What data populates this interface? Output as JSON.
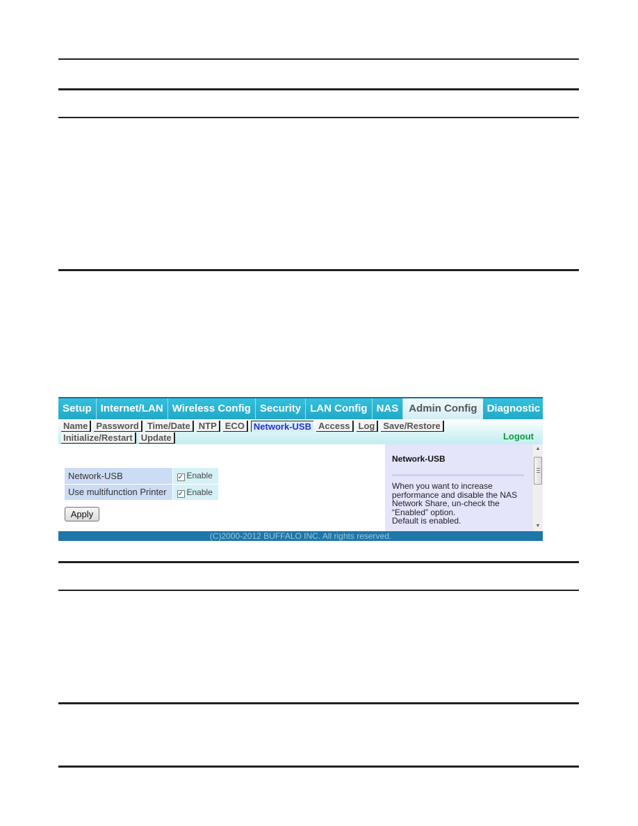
{
  "top_nav": {
    "tabs": [
      {
        "label": "Setup",
        "active": false
      },
      {
        "label": "Internet/LAN",
        "active": false
      },
      {
        "label": "Wireless Config",
        "active": false
      },
      {
        "label": "Security",
        "active": false
      },
      {
        "label": "LAN Config",
        "active": false
      },
      {
        "label": "NAS",
        "active": false
      },
      {
        "label": "Admin Config",
        "active": true
      },
      {
        "label": "Diagnostic",
        "active": false
      }
    ]
  },
  "sub_nav": {
    "row1": [
      {
        "label": "Name",
        "active": false
      },
      {
        "label": "Password",
        "active": false
      },
      {
        "label": "Time/Date",
        "active": false
      },
      {
        "label": "NTP",
        "active": false
      },
      {
        "label": "ECO",
        "active": false
      },
      {
        "label": "Network-USB",
        "active": true
      },
      {
        "label": "Access",
        "active": false
      },
      {
        "label": "Log",
        "active": false
      },
      {
        "label": "Save/Restore",
        "active": false
      }
    ],
    "row2": [
      {
        "label": "Initialize/Restart",
        "active": false
      },
      {
        "label": "Update",
        "active": false
      }
    ],
    "logout_label": "Logout"
  },
  "settings": {
    "rows": [
      {
        "label": "Network-USB",
        "checked": true,
        "option_label": "Enable"
      },
      {
        "label": "Use multifunction Printer",
        "checked": true,
        "option_label": "Enable"
      }
    ],
    "apply_label": "Apply"
  },
  "help": {
    "title": "Network-USB",
    "text_lines": [
      "When you want to increase",
      "performance and disable the NAS",
      "Network Share, un-check the",
      "“Enabled” option.",
      "Default is enabled."
    ]
  },
  "footer": {
    "copyright": "(C)2000-2012 BUFFALO INC. All rights reserved."
  },
  "colors": {
    "nav_bg": "#2ab4d3",
    "active_tab_text": "#555555",
    "active_subtab_text": "#2233cc",
    "logout": "#129a3a",
    "footer_bg": "#1d77a8",
    "help_bg": "#e4e4fb"
  }
}
